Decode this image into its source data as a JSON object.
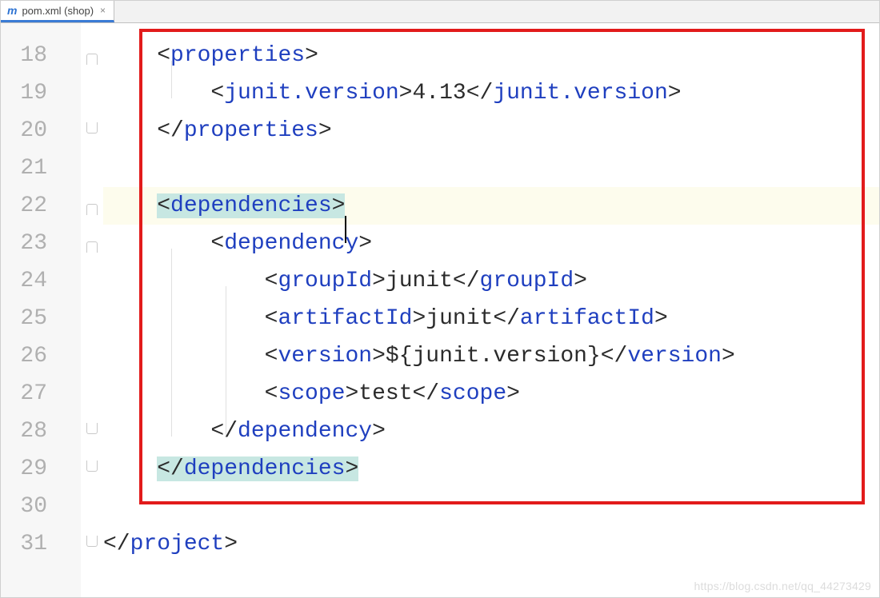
{
  "tab": {
    "icon_text": "m",
    "label": "pom.xml (shop)",
    "close_glyph": "×"
  },
  "gutter": {
    "start": 18,
    "end": 31
  },
  "code": {
    "l18": {
      "tag": "properties"
    },
    "l19": {
      "tag": "junit.version",
      "value": "4.13"
    },
    "l20": {
      "tag": "properties"
    },
    "l22": {
      "tag": "dependencies"
    },
    "l23": {
      "tag": "dependency"
    },
    "l24": {
      "tag": "groupId",
      "value": "junit"
    },
    "l25": {
      "tag": "artifactId",
      "value": "junit"
    },
    "l26": {
      "tag": "version",
      "value": "${junit.version}"
    },
    "l27": {
      "tag": "scope",
      "value": "test"
    },
    "l28": {
      "tag": "dependency"
    },
    "l29": {
      "tag": "dependencies"
    },
    "l31": {
      "tag": "project"
    }
  },
  "watermark": "https://blog.csdn.net/qq_44273429"
}
